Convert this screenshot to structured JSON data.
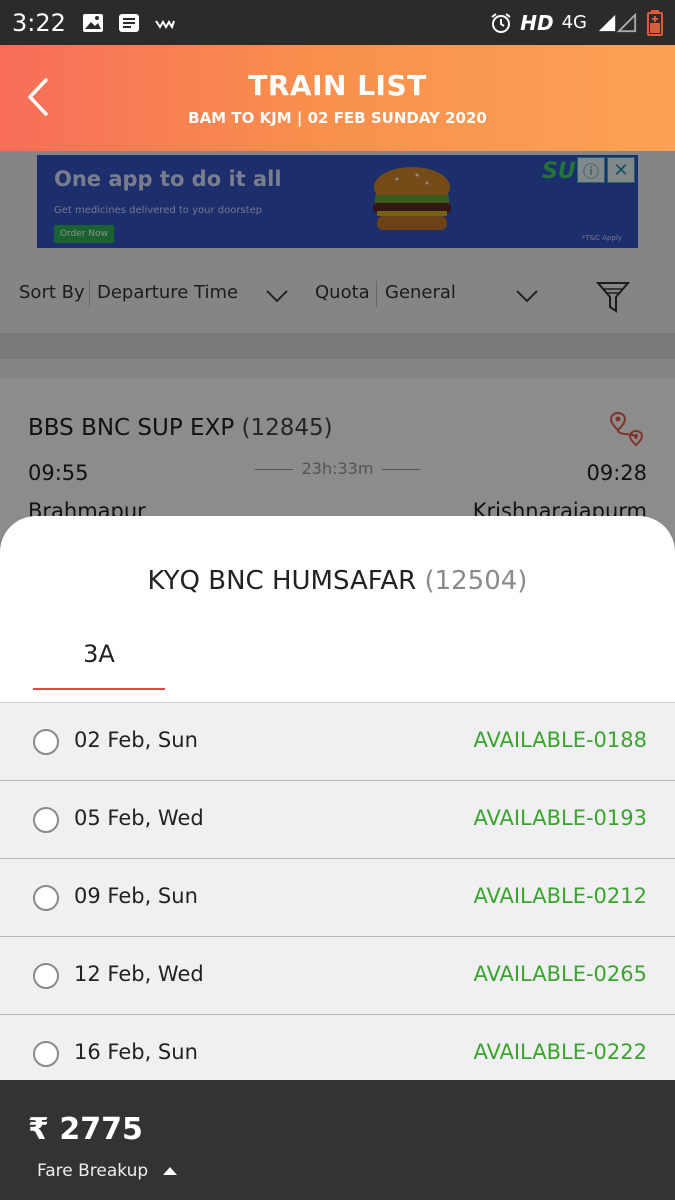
{
  "status_bar": {
    "time": "3:22",
    "network_hd": "HD",
    "network_type": "4G",
    "icons": [
      "gallery-icon",
      "message-icon",
      "wifi-signal-icon",
      "alarm-icon",
      "signal-icon",
      "battery-icon"
    ]
  },
  "header": {
    "title": "TRAIN LIST",
    "subtitle": "BAM TO KJM | 02 FEB SUNDAY 2020",
    "gradient_colors": [
      "#f76d5a",
      "#fba256"
    ]
  },
  "ad": {
    "headline": "One app to do it all",
    "subline": "Get medicines delivered to your doorstep",
    "button": "Order Now",
    "fine_print": "*T&C Apply",
    "info_glyph": "ⓘ",
    "close_glyph": "✕",
    "brand": "SU"
  },
  "filters": {
    "sort_label": "Sort By",
    "sort_value": "Departure Time",
    "quota_label": "Quota",
    "quota_value": "General"
  },
  "train_card": {
    "name": "BBS BNC SUP EXP",
    "number": "(12845)",
    "departure": "09:55",
    "duration": "23h:33m",
    "arrival": "09:28",
    "from": "Brahmapur",
    "to": "Krishnarajapurm"
  },
  "sheet": {
    "train_name": "KYQ BNC HUMSAFAR",
    "train_number": "(12504)",
    "class_tab": "3A",
    "availability": [
      {
        "date": "02 Feb, Sun",
        "status": "AVAILABLE-0188"
      },
      {
        "date": "05 Feb, Wed",
        "status": "AVAILABLE-0193"
      },
      {
        "date": "09 Feb, Sun",
        "status": "AVAILABLE-0212"
      },
      {
        "date": "12 Feb, Wed",
        "status": "AVAILABLE-0265"
      },
      {
        "date": "16 Feb, Sun",
        "status": "AVAILABLE-0222"
      }
    ],
    "accent_color": "#e8473f",
    "available_color": "#3aa52c"
  },
  "bottom_bar": {
    "fare": "₹ 2775",
    "fare_breakup": "Fare Breakup"
  }
}
